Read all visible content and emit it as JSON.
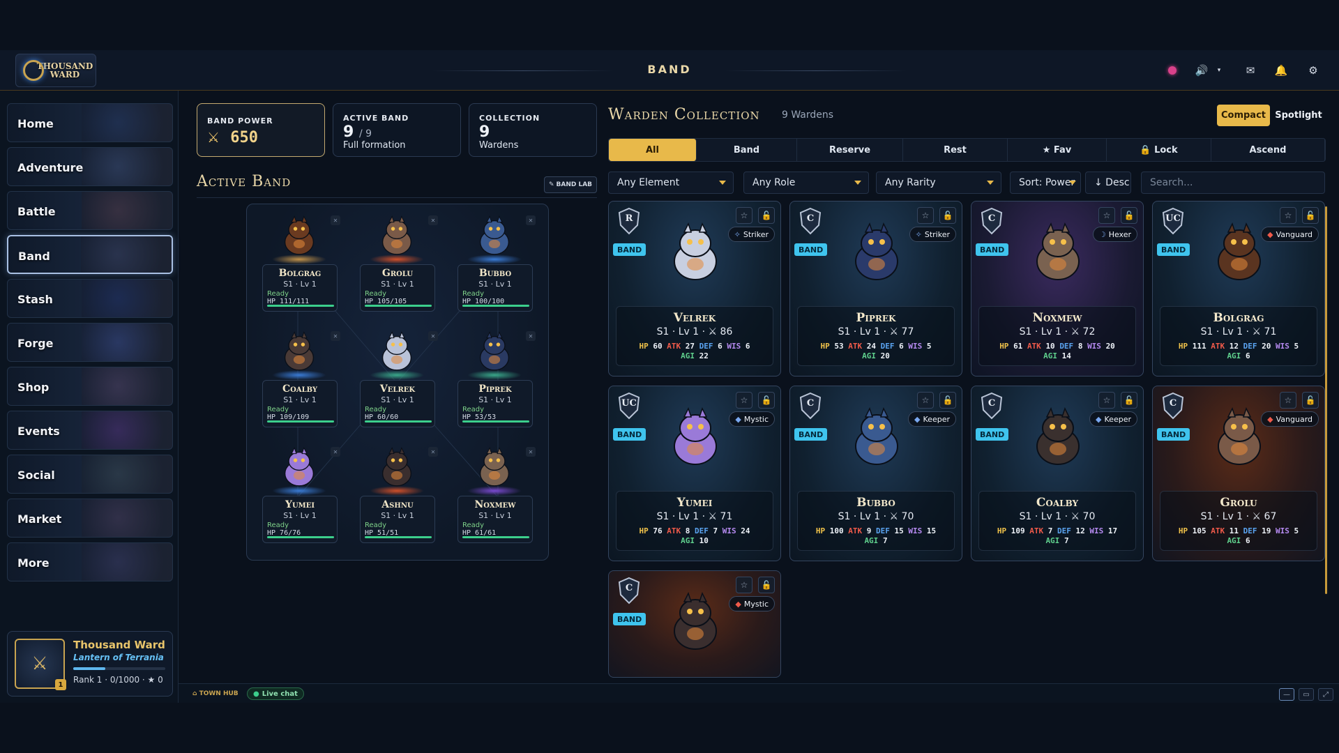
{
  "app": {
    "logo_text": "THOUSAND WARD",
    "screen_title": "BAND"
  },
  "topbar_icons": [
    "record-icon",
    "speaker-icon",
    "chevron-down-icon",
    "mail-icon",
    "bell-icon",
    "settings-icon"
  ],
  "sidebar": {
    "items": [
      {
        "label": "Home"
      },
      {
        "label": "Adventure"
      },
      {
        "label": "Battle"
      },
      {
        "label": "Band"
      },
      {
        "label": "Stash"
      },
      {
        "label": "Forge"
      },
      {
        "label": "Shop"
      },
      {
        "label": "Events"
      },
      {
        "label": "Social"
      },
      {
        "label": "Market"
      },
      {
        "label": "More"
      }
    ],
    "active_index": 3
  },
  "profile": {
    "name": "Thousand Ward",
    "subtitle": "Lantern of Terrania",
    "level_badge": "1",
    "rank": "Rank 1 · 0/1000 · ★ 0",
    "progress": 0.35
  },
  "stats": {
    "band_power_label": "BAND POWER",
    "band_power_value": "650",
    "active_band_label": "ACTIVE BAND",
    "active_band_value": "9",
    "active_band_max": "/ 9",
    "active_band_sub": "Full formation",
    "collection_label": "COLLECTION",
    "collection_value": "9",
    "collection_sub": "Wardens"
  },
  "active_band": {
    "title": "Active Band",
    "bandlab_label": "BAND LAB",
    "slots": [
      {
        "name": "Bolgrag",
        "level": "S1 · Lv 1",
        "status": "Ready",
        "hp": "HP 111/111",
        "hp_frac": 1,
        "glow": "#c2924a",
        "color": "#6a3a20"
      },
      {
        "name": "Grolu",
        "level": "S1 · Lv 1",
        "status": "Ready",
        "hp": "HP 105/105",
        "hp_frac": 1,
        "glow": "#d0502a",
        "color": "#7a5a48"
      },
      {
        "name": "Bubbo",
        "level": "S1 · Lv 1",
        "status": "Ready",
        "hp": "HP 100/100",
        "hp_frac": 1,
        "glow": "#3a7bd5",
        "color": "#3a5a90"
      },
      {
        "name": "Coalby",
        "level": "S1 · Lv 1",
        "status": "Ready",
        "hp": "HP 109/109",
        "hp_frac": 1,
        "glow": "#3a7bd5",
        "color": "#4a3a36"
      },
      {
        "name": "Velrek",
        "level": "S1 · Lv 1",
        "status": "Ready",
        "hp": "HP 60/60",
        "hp_frac": 1,
        "glow": "#3aa88a",
        "color": "#b9c2d8"
      },
      {
        "name": "Piprek",
        "level": "S1 · Lv 1",
        "status": "Ready",
        "hp": "HP 53/53",
        "hp_frac": 1,
        "glow": "#3aa88a",
        "color": "#2a3a62"
      },
      {
        "name": "Yumei",
        "level": "S1 · Lv 1",
        "status": "Ready",
        "hp": "HP 76/76",
        "hp_frac": 1,
        "glow": "#3a7bd5",
        "color": "#9a7ad8"
      },
      {
        "name": "Ashnu",
        "level": "S1 · Lv 1",
        "status": "Ready",
        "hp": "HP 51/51",
        "hp_frac": 1,
        "glow": "#d0502a",
        "color": "#3a2e2e"
      },
      {
        "name": "Noxmew",
        "level": "S1 · Lv 1",
        "status": "Ready",
        "hp": "HP 61/61",
        "hp_frac": 1,
        "glow": "#7a4ad0",
        "color": "#7a6250"
      }
    ]
  },
  "collection": {
    "title": "Warden Collection",
    "count": "9 Wardens",
    "view_compact": "Compact",
    "view_spotlight": "Spotlight",
    "tabs": [
      {
        "label": "All"
      },
      {
        "label": "Band"
      },
      {
        "label": "Reserve"
      },
      {
        "label": "Rest"
      },
      {
        "label": "★ Fav"
      },
      {
        "label": "🔒 Lock"
      },
      {
        "label": "Ascend"
      }
    ],
    "filters": {
      "element": "Any Element",
      "role": "Any Role",
      "rarity": "Any Rarity",
      "sort": "Sort: Power",
      "order": "↓ Desc",
      "search_placeholder": "Search..."
    },
    "band_tag": "BAND",
    "cards": [
      {
        "name": "Velrek",
        "level": "S1 · Lv 1 · ⚔ 86",
        "role": "Striker",
        "role_icon": "✧",
        "rarity": "R",
        "bg": "",
        "hp": "60",
        "atk": "27",
        "def": "6",
        "wis": "6",
        "agi": "22",
        "color": "#c8cfe0"
      },
      {
        "name": "Piprek",
        "level": "S1 · Lv 1 · ⚔ 77",
        "role": "Striker",
        "role_icon": "✧",
        "rarity": "C",
        "bg": "",
        "hp": "53",
        "atk": "24",
        "def": "6",
        "wis": "5",
        "agi": "20",
        "color": "#2a3a6a"
      },
      {
        "name": "Noxmew",
        "level": "S1 · Lv 1 · ⚔ 72",
        "role": "Hexer",
        "role_icon": "☽",
        "rarity": "C",
        "bg": "purple",
        "hp": "61",
        "atk": "10",
        "def": "8",
        "wis": "20",
        "agi": "14",
        "color": "#7a6250"
      },
      {
        "name": "Bolgrag",
        "level": "S1 · Lv 1 · ⚔ 71",
        "role": "Vanguard",
        "role_icon": "◆",
        "rarity": "UC",
        "bg": "",
        "hp": "111",
        "atk": "12",
        "def": "20",
        "wis": "5",
        "agi": "6",
        "color": "#5a3420"
      },
      {
        "name": "Yumei",
        "level": "S1 · Lv 1 · ⚔ 71",
        "role": "Mystic",
        "role_icon": "◆",
        "rarity": "UC",
        "bg": "",
        "hp": "76",
        "atk": "8",
        "def": "7",
        "wis": "24",
        "agi": "10",
        "color": "#9a7ad8"
      },
      {
        "name": "Bubbo",
        "level": "S1 · Lv 1 · ⚔ 70",
        "role": "Keeper",
        "role_icon": "◆",
        "rarity": "C",
        "bg": "",
        "hp": "100",
        "atk": "9",
        "def": "15",
        "wis": "15",
        "agi": "7",
        "color": "#3a5a90"
      },
      {
        "name": "Coalby",
        "level": "S1 · Lv 1 · ⚔ 70",
        "role": "Keeper",
        "role_icon": "◆",
        "rarity": "C",
        "bg": "",
        "hp": "109",
        "atk": "7",
        "def": "12",
        "wis": "17",
        "agi": "7",
        "color": "#3a302e"
      },
      {
        "name": "Grolu",
        "level": "S1 · Lv 1 · ⚔ 67",
        "role": "Vanguard",
        "role_icon": "◆",
        "rarity": "C",
        "bg": "ember",
        "hp": "105",
        "atk": "11",
        "def": "19",
        "wis": "5",
        "agi": "6",
        "color": "#7a5a48"
      },
      {
        "name": "",
        "level": "",
        "role": "Mystic",
        "role_icon": "◆",
        "rarity": "C",
        "bg": "ember",
        "hp": "",
        "atk": "",
        "def": "",
        "wis": "",
        "agi": "",
        "color": "#3a2e2e",
        "partial": true
      }
    ]
  },
  "footer": {
    "town_hub": "⌂ TOWN HUB",
    "live_chat": "Live chat"
  }
}
